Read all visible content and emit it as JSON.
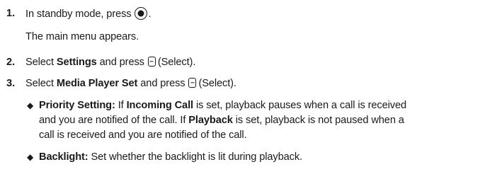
{
  "steps": [
    {
      "number": "1.",
      "pre": "In standby mode, press ",
      "post": ".",
      "key_icon": "center-select-key-icon",
      "followup": "The main menu appears."
    },
    {
      "number": "2.",
      "pre": "Select ",
      "bold": "Settings",
      "mid": " and press ",
      "key_icon": "left-soft-key-icon",
      "post": "(Select)."
    },
    {
      "number": "3.",
      "pre": "Select ",
      "bold": "Media Player Set",
      "mid": " and press ",
      "key_icon": "left-soft-key-icon",
      "post": "(Select)."
    }
  ],
  "bullets": [
    {
      "marker": "◆",
      "term": "Priority Setting:",
      "lines": [
        {
          "a": " If ",
          "b": "Incoming Call",
          "c": " is set, playback pauses when a call is received"
        },
        {
          "a": "and you are notified of the call. If ",
          "b": "Playback",
          "c": " is set, playback is not paused when a"
        },
        {
          "a": "call is received and you are notified of the call.",
          "b": "",
          "c": ""
        }
      ]
    },
    {
      "marker": "◆",
      "term": "Backlight:",
      "lines": [
        {
          "a": " Set whether the backlight is lit during playback.",
          "b": "",
          "c": ""
        }
      ]
    }
  ]
}
